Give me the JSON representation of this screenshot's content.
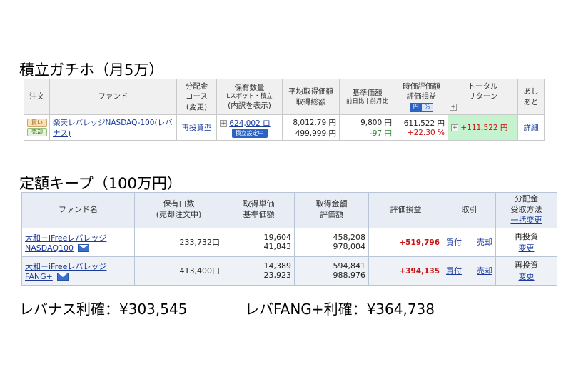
{
  "heading1": "積立ガチホ（月5万）",
  "heading2": "定額キープ（100万円）",
  "profit1": "レバナス利確：¥303,545",
  "profit2": "レバFANG+利確：¥364,738",
  "table1": {
    "headers": {
      "order": "注文",
      "fund": "ファンド",
      "dist_1": "分配金",
      "dist_2": "コース",
      "dist_3": "(変更)",
      "qty_1": "保有数量",
      "qty_2": "Lスポット・積立",
      "qty_3": "(内訳を表示)",
      "avg_1": "平均取得価額",
      "avg_2": "取得総額",
      "base_1": "基準価額",
      "base_2a": "前日比",
      "base_2b": "前月比",
      "eval_1": "時価評価額",
      "eval_2": "評価損益",
      "eval_yen": "円",
      "eval_pct": "%",
      "total_1": "トータル",
      "total_2": "リターン",
      "hist_1": "あし",
      "hist_2": "あと"
    },
    "row": {
      "buy": "買い",
      "sell": "売却",
      "fund_name": "楽天レバレッジNASDAQ-100(レバナス)",
      "course": "再投資型",
      "qty": "624,002 口",
      "qty_tag": "積立設定中",
      "avg_price": "8,012.79 円",
      "total_cost": "499,999 円",
      "base_price": "9,800 円",
      "base_change": "-97 円",
      "market_value": "611,522 円",
      "gain_pct": "+22.30 %",
      "total_return": "+111,522 円",
      "detail": "詳細"
    }
  },
  "table2": {
    "headers": {
      "fund": "ファンド名",
      "units_1": "保有口数",
      "units_2": "(売却注文中)",
      "unit_1": "取得単価",
      "unit_2": "基準価額",
      "amount_1": "取得金額",
      "amount_2": "評価額",
      "gain": "評価損益",
      "trade": "取引",
      "dist_1": "分配金",
      "dist_2": "受取方法",
      "dist_3": "一括変更"
    },
    "rows": [
      {
        "fund": "大和－iFreeレバレッジ NASDAQ100",
        "units": "233,732口",
        "unit_price": "19,604",
        "base_price": "41,843",
        "cost": "458,208",
        "value": "978,004",
        "gain": "+519,796",
        "buy": "買付",
        "sell": "売却",
        "method": "再投資",
        "change": "変更"
      },
      {
        "fund": "大和－iFreeレバレッジ FANG+",
        "units": "413,400口",
        "unit_price": "14,389",
        "base_price": "23,923",
        "cost": "594,841",
        "value": "988,976",
        "gain": "+394,135",
        "buy": "買付",
        "sell": "売却",
        "method": "再投資",
        "change": "変更"
      }
    ]
  }
}
